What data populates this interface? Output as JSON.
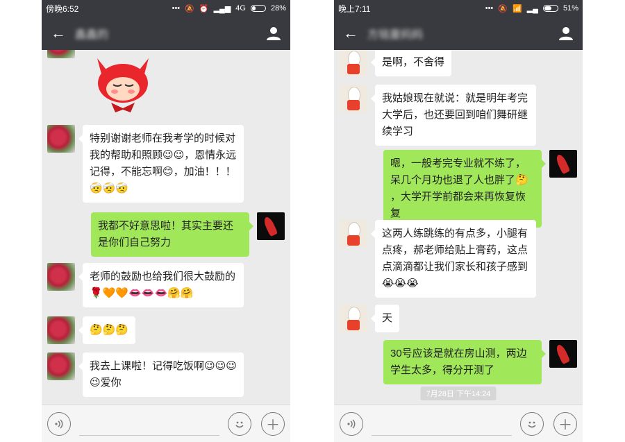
{
  "left": {
    "status": {
      "time": "傍晚6:52",
      "network": "4G",
      "battery": "28%",
      "battery_level": 0.28
    },
    "header": {
      "title": "鑫鑫的"
    },
    "messages": [
      {
        "dir": "in",
        "avatar": "flower",
        "text": "特别谢谢老师在我考学的时候对我的帮助和照顾",
        "emoji_mid": [
          "😉",
          "😉"
        ],
        "text2": "，恩情永远记得，不能忘啊",
        "emoji2": [
          "😊"
        ],
        "text3": "，加油！！！",
        "emoji3": [
          "🤕",
          "🤕",
          "🤕"
        ]
      },
      {
        "dir": "out",
        "avatar": "dancer",
        "text": "我都不好意思啦！其实主要还是你们自己努力"
      },
      {
        "dir": "in",
        "avatar": "flower",
        "text": "老师的鼓励也给我们很大鼓励的",
        "emoji3": [
          "🌹",
          "🧡",
          "🧡",
          "👄",
          "👄",
          "👄",
          "🤗",
          "🤗"
        ]
      },
      {
        "dir": "in",
        "avatar": "flower",
        "text": "",
        "emoji3": [
          "🤔",
          "🤔",
          "🤔"
        ]
      },
      {
        "dir": "in",
        "avatar": "flower",
        "text": "我去上课啦！记得吃饭啊",
        "emoji_mid": [
          "😉",
          "😉",
          "😉",
          "😉"
        ],
        "text2": "爱你"
      }
    ]
  },
  "right": {
    "status": {
      "time": "晚上7:11",
      "battery": "51%",
      "battery_level": 0.51
    },
    "header": {
      "title": "方铭曼妈妈"
    },
    "messages": [
      {
        "dir": "in",
        "avatar": "rabbit",
        "text": "是啊，不舍得"
      },
      {
        "dir": "in",
        "avatar": "rabbit",
        "text": "我姑娘现在就说：就是明年考完大学后，也还要回到咱们舞研继续学习"
      },
      {
        "dir": "out",
        "avatar": "dancer",
        "text": "嗯，一般考完专业就不练了，呆几个月功也退了人也胖了",
        "emoji_mid": [
          "🤔"
        ],
        "text2": "，大学开学前都会来再恢复恢复"
      },
      {
        "dir": "in",
        "avatar": "rabbit",
        "text": "这两人练跳练的有点多，小腿有点疼，郝老师给贴上膏药，这点点滴滴都让我们家长和孩子感到",
        "emoji_mid": [
          "😭",
          "😭",
          "😭"
        ]
      },
      {
        "dir": "in",
        "avatar": "rabbit",
        "text": "天"
      },
      {
        "dir": "out",
        "avatar": "dancer",
        "text": "30号应该是就在房山测，两边学生太多，得分开测了"
      }
    ],
    "timestamp": "7月28日 下午14:24"
  },
  "icons": {
    "back": "back-arrow-icon",
    "profile": "person-icon",
    "voice": "voice-icon",
    "emoji": "smiley-icon",
    "plus": "plus-icon"
  }
}
